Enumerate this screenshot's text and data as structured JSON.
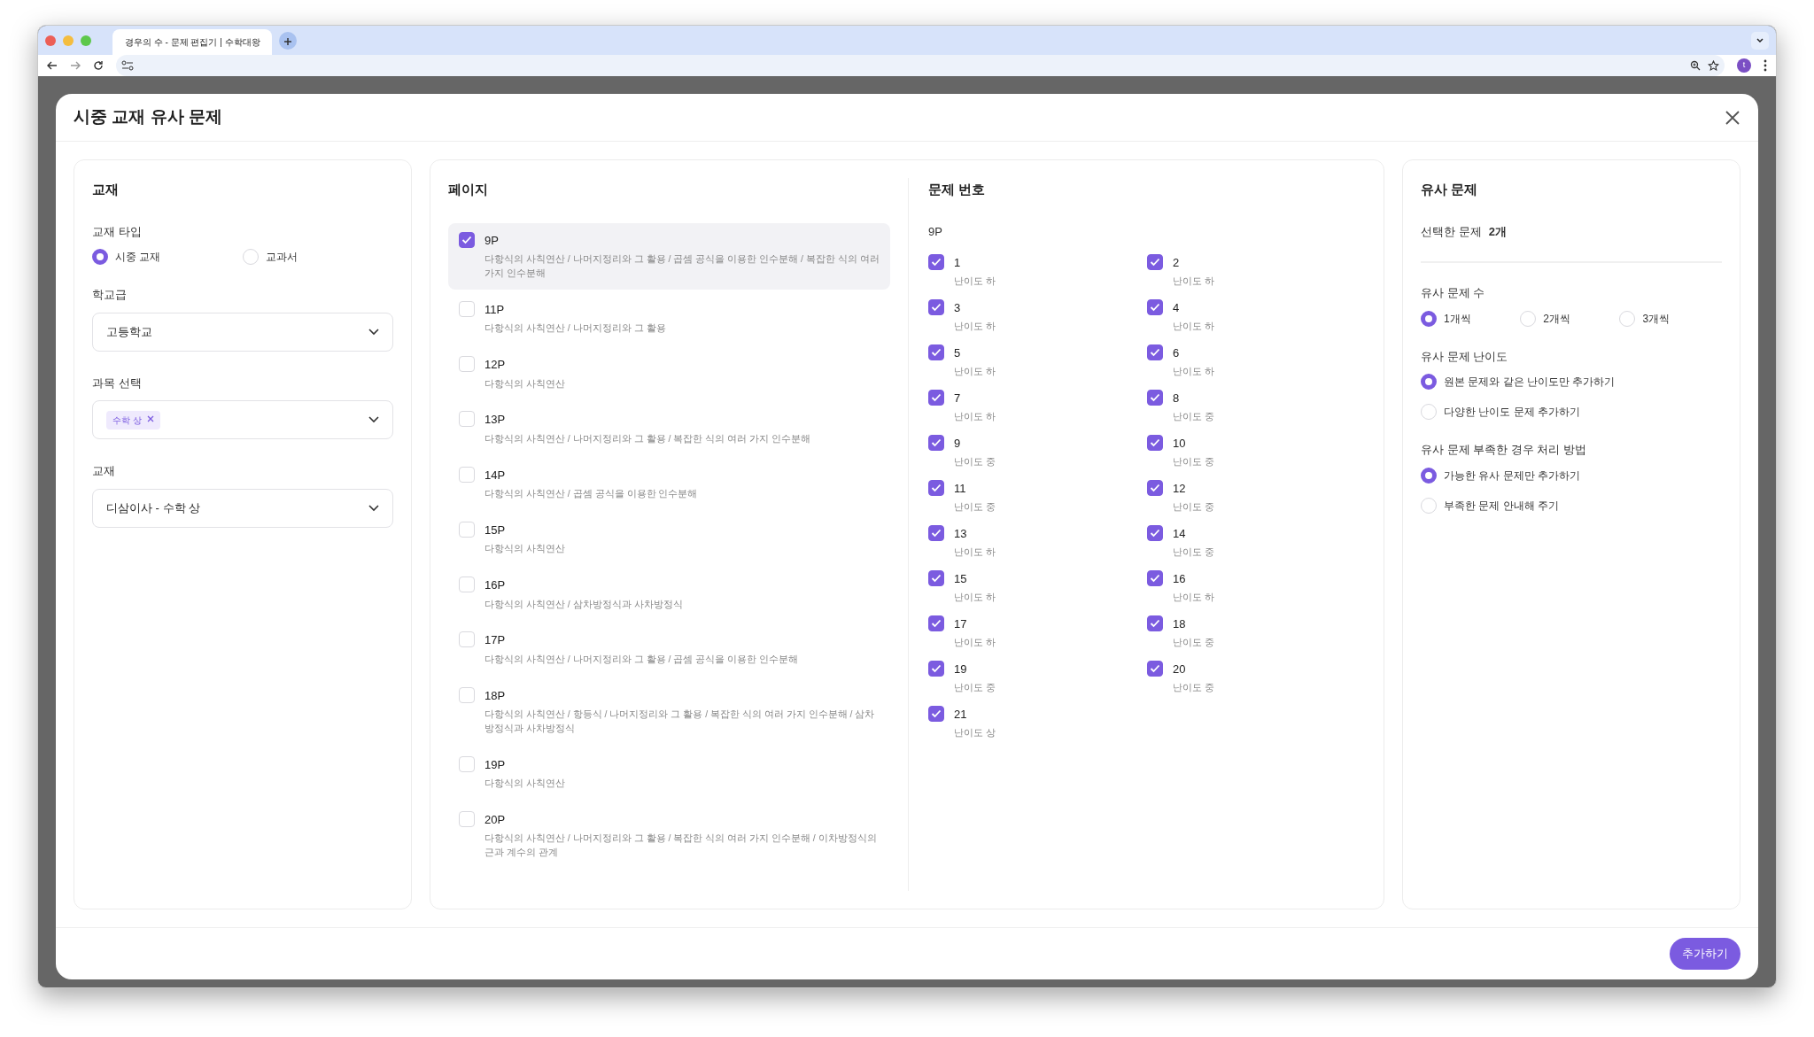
{
  "browser": {
    "tab_title": "경우의 수 - 문제 편집기 | 수학대왕",
    "avatar": "t"
  },
  "modal": {
    "title": "시중 교재 유사 문제",
    "submit": "추가하기"
  },
  "textbook_panel": {
    "heading": "교재",
    "type_label": "교재 타입",
    "type_options": [
      {
        "label": "시중 교재",
        "selected": true
      },
      {
        "label": "교과서",
        "selected": false
      }
    ],
    "school_label": "학교급",
    "school_value": "고등학교",
    "subject_label": "과목 선택",
    "subject_tags": [
      "수학 상"
    ],
    "book_label": "교재",
    "book_value": "디삼이사 - 수학 상"
  },
  "pages_panel": {
    "heading": "페이지",
    "items": [
      {
        "label": "9P",
        "topics": "다항식의 사칙연산 / 나머지정리와 그 활용 / 곱셈 공식을 이용한 인수분해 / 복잡한 식의 여러 가지 인수분해",
        "checked": true
      },
      {
        "label": "11P",
        "topics": "다항식의 사칙연산 / 나머지정리와 그 활용",
        "checked": false
      },
      {
        "label": "12P",
        "topics": "다항식의 사칙연산",
        "checked": false
      },
      {
        "label": "13P",
        "topics": "다항식의 사칙연산 / 나머지정리와 그 활용 / 복잡한 식의 여러 가지 인수분해",
        "checked": false
      },
      {
        "label": "14P",
        "topics": "다항식의 사칙연산 / 곱셈 공식을 이용한 인수분해",
        "checked": false
      },
      {
        "label": "15P",
        "topics": "다항식의 사칙연산",
        "checked": false
      },
      {
        "label": "16P",
        "topics": "다항식의 사칙연산 / 삼차방정식과 사차방정식",
        "checked": false
      },
      {
        "label": "17P",
        "topics": "다항식의 사칙연산 / 나머지정리와 그 활용 / 곱셈 공식을 이용한 인수분해",
        "checked": false
      },
      {
        "label": "18P",
        "topics": "다항식의 사칙연산 / 항등식 / 나머지정리와 그 활용 / 복잡한 식의 여러 가지 인수분해 / 삼차방정식과 사차방정식",
        "checked": false
      },
      {
        "label": "19P",
        "topics": "다항식의 사칙연산",
        "checked": false
      },
      {
        "label": "20P",
        "topics": "다항식의 사칙연산 / 나머지정리와 그 활용 / 복잡한 식의 여러 가지 인수분해 / 이차방정식의 근과 계수의 관계",
        "checked": false
      }
    ]
  },
  "problems_panel": {
    "heading": "문제 번호",
    "page": "9P",
    "items": [
      {
        "number": "1",
        "difficulty": "난이도 하",
        "checked": true
      },
      {
        "number": "2",
        "difficulty": "난이도 하",
        "checked": true
      },
      {
        "number": "3",
        "difficulty": "난이도 하",
        "checked": true
      },
      {
        "number": "4",
        "difficulty": "난이도 하",
        "checked": true
      },
      {
        "number": "5",
        "difficulty": "난이도 하",
        "checked": true
      },
      {
        "number": "6",
        "difficulty": "난이도 하",
        "checked": true
      },
      {
        "number": "7",
        "difficulty": "난이도 하",
        "checked": true
      },
      {
        "number": "8",
        "difficulty": "난이도 중",
        "checked": true
      },
      {
        "number": "9",
        "difficulty": "난이도 중",
        "checked": true
      },
      {
        "number": "10",
        "difficulty": "난이도 중",
        "checked": true
      },
      {
        "number": "11",
        "difficulty": "난이도 중",
        "checked": true
      },
      {
        "number": "12",
        "difficulty": "난이도 중",
        "checked": true
      },
      {
        "number": "13",
        "difficulty": "난이도 하",
        "checked": true
      },
      {
        "number": "14",
        "difficulty": "난이도 중",
        "checked": true
      },
      {
        "number": "15",
        "difficulty": "난이도 하",
        "checked": true
      },
      {
        "number": "16",
        "difficulty": "난이도 하",
        "checked": true
      },
      {
        "number": "17",
        "difficulty": "난이도 하",
        "checked": true
      },
      {
        "number": "18",
        "difficulty": "난이도 중",
        "checked": true
      },
      {
        "number": "19",
        "difficulty": "난이도 중",
        "checked": true
      },
      {
        "number": "20",
        "difficulty": "난이도 중",
        "checked": true
      },
      {
        "number": "21",
        "difficulty": "난이도 상",
        "checked": true
      }
    ]
  },
  "similar_panel": {
    "heading": "유사 문제",
    "selected_label": "선택한 문제",
    "selected_count": "2개",
    "groups": [
      {
        "label": "유사 문제 수",
        "kind": "inline",
        "options": [
          {
            "label": "1개씩",
            "selected": true
          },
          {
            "label": "2개씩",
            "selected": false
          },
          {
            "label": "3개씩",
            "selected": false
          }
        ]
      },
      {
        "label": "유사 문제 난이도",
        "kind": "stacked",
        "options": [
          {
            "label": "원본 문제와 같은 난이도만 추가하기",
            "selected": true
          },
          {
            "label": "다양한 난이도 문제 추가하기",
            "selected": false
          }
        ]
      },
      {
        "label": "유사 문제 부족한 경우 처리 방법",
        "kind": "stacked",
        "options": [
          {
            "label": "가능한 유사 문제만 추가하기",
            "selected": true
          },
          {
            "label": "부족한 문제 안내해 주기",
            "selected": false
          }
        ]
      }
    ]
  }
}
